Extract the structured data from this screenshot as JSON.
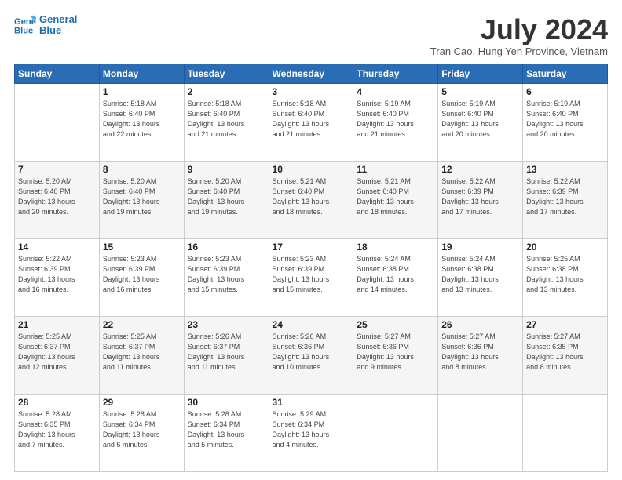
{
  "header": {
    "logo": {
      "line1": "General",
      "line2": "Blue"
    },
    "title": "July 2024",
    "subtitle": "Tran Cao, Hung Yen Province, Vietnam"
  },
  "days": [
    "Sunday",
    "Monday",
    "Tuesday",
    "Wednesday",
    "Thursday",
    "Friday",
    "Saturday"
  ],
  "weeks": [
    [
      {
        "day": "",
        "info": ""
      },
      {
        "day": "1",
        "info": "Sunrise: 5:18 AM\nSunset: 6:40 PM\nDaylight: 13 hours\nand 22 minutes."
      },
      {
        "day": "2",
        "info": "Sunrise: 5:18 AM\nSunset: 6:40 PM\nDaylight: 13 hours\nand 21 minutes."
      },
      {
        "day": "3",
        "info": "Sunrise: 5:18 AM\nSunset: 6:40 PM\nDaylight: 13 hours\nand 21 minutes."
      },
      {
        "day": "4",
        "info": "Sunrise: 5:19 AM\nSunset: 6:40 PM\nDaylight: 13 hours\nand 21 minutes."
      },
      {
        "day": "5",
        "info": "Sunrise: 5:19 AM\nSunset: 6:40 PM\nDaylight: 13 hours\nand 20 minutes."
      },
      {
        "day": "6",
        "info": "Sunrise: 5:19 AM\nSunset: 6:40 PM\nDaylight: 13 hours\nand 20 minutes."
      }
    ],
    [
      {
        "day": "7",
        "info": "Sunrise: 5:20 AM\nSunset: 6:40 PM\nDaylight: 13 hours\nand 20 minutes."
      },
      {
        "day": "8",
        "info": "Sunrise: 5:20 AM\nSunset: 6:40 PM\nDaylight: 13 hours\nand 19 minutes."
      },
      {
        "day": "9",
        "info": "Sunrise: 5:20 AM\nSunset: 6:40 PM\nDaylight: 13 hours\nand 19 minutes."
      },
      {
        "day": "10",
        "info": "Sunrise: 5:21 AM\nSunset: 6:40 PM\nDaylight: 13 hours\nand 18 minutes."
      },
      {
        "day": "11",
        "info": "Sunrise: 5:21 AM\nSunset: 6:40 PM\nDaylight: 13 hours\nand 18 minutes."
      },
      {
        "day": "12",
        "info": "Sunrise: 5:22 AM\nSunset: 6:39 PM\nDaylight: 13 hours\nand 17 minutes."
      },
      {
        "day": "13",
        "info": "Sunrise: 5:22 AM\nSunset: 6:39 PM\nDaylight: 13 hours\nand 17 minutes."
      }
    ],
    [
      {
        "day": "14",
        "info": "Sunrise: 5:22 AM\nSunset: 6:39 PM\nDaylight: 13 hours\nand 16 minutes."
      },
      {
        "day": "15",
        "info": "Sunrise: 5:23 AM\nSunset: 6:39 PM\nDaylight: 13 hours\nand 16 minutes."
      },
      {
        "day": "16",
        "info": "Sunrise: 5:23 AM\nSunset: 6:39 PM\nDaylight: 13 hours\nand 15 minutes."
      },
      {
        "day": "17",
        "info": "Sunrise: 5:23 AM\nSunset: 6:39 PM\nDaylight: 13 hours\nand 15 minutes."
      },
      {
        "day": "18",
        "info": "Sunrise: 5:24 AM\nSunset: 6:38 PM\nDaylight: 13 hours\nand 14 minutes."
      },
      {
        "day": "19",
        "info": "Sunrise: 5:24 AM\nSunset: 6:38 PM\nDaylight: 13 hours\nand 13 minutes."
      },
      {
        "day": "20",
        "info": "Sunrise: 5:25 AM\nSunset: 6:38 PM\nDaylight: 13 hours\nand 13 minutes."
      }
    ],
    [
      {
        "day": "21",
        "info": "Sunrise: 5:25 AM\nSunset: 6:37 PM\nDaylight: 13 hours\nand 12 minutes."
      },
      {
        "day": "22",
        "info": "Sunrise: 5:25 AM\nSunset: 6:37 PM\nDaylight: 13 hours\nand 11 minutes."
      },
      {
        "day": "23",
        "info": "Sunrise: 5:26 AM\nSunset: 6:37 PM\nDaylight: 13 hours\nand 11 minutes."
      },
      {
        "day": "24",
        "info": "Sunrise: 5:26 AM\nSunset: 6:36 PM\nDaylight: 13 hours\nand 10 minutes."
      },
      {
        "day": "25",
        "info": "Sunrise: 5:27 AM\nSunset: 6:36 PM\nDaylight: 13 hours\nand 9 minutes."
      },
      {
        "day": "26",
        "info": "Sunrise: 5:27 AM\nSunset: 6:36 PM\nDaylight: 13 hours\nand 8 minutes."
      },
      {
        "day": "27",
        "info": "Sunrise: 5:27 AM\nSunset: 6:35 PM\nDaylight: 13 hours\nand 8 minutes."
      }
    ],
    [
      {
        "day": "28",
        "info": "Sunrise: 5:28 AM\nSunset: 6:35 PM\nDaylight: 13 hours\nand 7 minutes."
      },
      {
        "day": "29",
        "info": "Sunrise: 5:28 AM\nSunset: 6:34 PM\nDaylight: 13 hours\nand 6 minutes."
      },
      {
        "day": "30",
        "info": "Sunrise: 5:28 AM\nSunset: 6:34 PM\nDaylight: 13 hours\nand 5 minutes."
      },
      {
        "day": "31",
        "info": "Sunrise: 5:29 AM\nSunset: 6:34 PM\nDaylight: 13 hours\nand 4 minutes."
      },
      {
        "day": "",
        "info": ""
      },
      {
        "day": "",
        "info": ""
      },
      {
        "day": "",
        "info": ""
      }
    ]
  ]
}
